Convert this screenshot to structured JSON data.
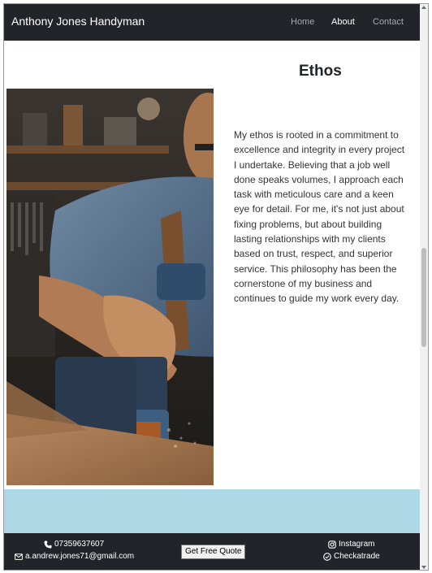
{
  "navbar": {
    "brand": "Anthony Jones Handyman",
    "links": [
      {
        "label": "Home",
        "active": false
      },
      {
        "label": "About",
        "active": true
      },
      {
        "label": "Contact",
        "active": false
      }
    ]
  },
  "main": {
    "title": "Ethos",
    "paragraph": "My ethos is rooted in a commitment to excellence and integrity in every project I undertake. Believing that a job well done speaks volumes, I approach each task with meticulous care and a keen eye for detail. For me, it's not just about fixing problems, but about building lasting relationships with my clients based on trust, respect, and superior service. This philosophy has been the cornerstone of my business and continues to guide my work every day.",
    "image_icon": "handyman-drill-photo"
  },
  "footer": {
    "phone": "07359637607",
    "email": "a.andrew.jones71@gmail.com",
    "quote_button": "Get Free Quote",
    "instagram": "Instagram",
    "checkatrade": "Checkatrade"
  },
  "colors": {
    "navbar_bg": "#212529",
    "band_bg": "#add8e6",
    "footer_bg": "#212529"
  }
}
